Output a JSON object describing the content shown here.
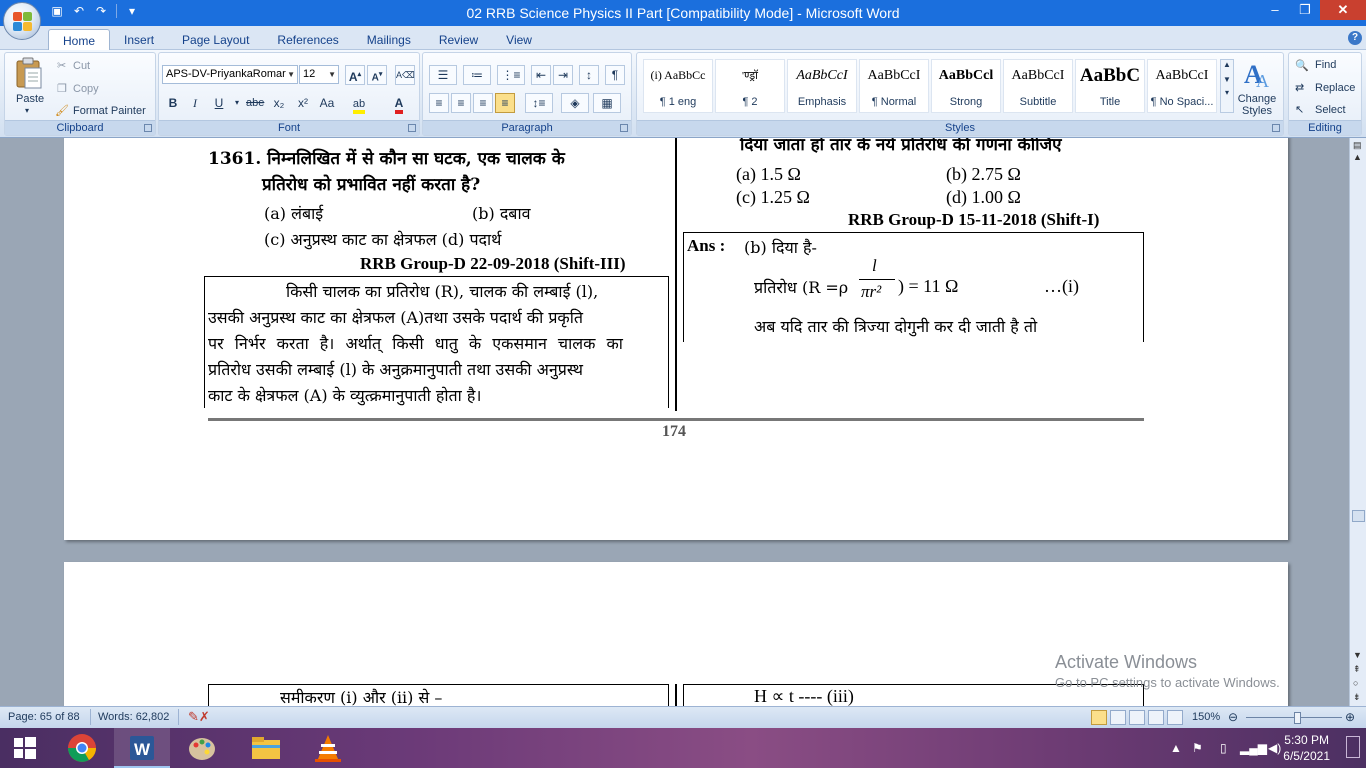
{
  "window": {
    "title": "02 RRB Science Physics II Part [Compatibility Mode] - Microsoft Word",
    "minimize": "–",
    "restore": "❐",
    "close": "✕"
  },
  "tabs": [
    "Home",
    "Insert",
    "Page Layout",
    "References",
    "Mailings",
    "Review",
    "View"
  ],
  "ribbon": {
    "clipboard": {
      "label": "Clipboard",
      "paste": "Paste",
      "cut": "Cut",
      "copy": "Copy",
      "format_painter": "Format Painter"
    },
    "font": {
      "label": "Font",
      "font_name": "APS-DV-PriyankaRomar",
      "font_size": "12",
      "bold": "B",
      "italic": "I",
      "underline": "U",
      "strike": "abe",
      "subscript": "x₂",
      "superscript": "x²",
      "change_case": "Aa"
    },
    "paragraph": {
      "label": "Paragraph"
    },
    "styles": {
      "label": "Styles",
      "items": [
        {
          "sample": "(i) AaBbCc",
          "name": "¶ 1 eng"
        },
        {
          "sample": "'ण्ड्रॉ",
          "name": "¶ 2"
        },
        {
          "sample": "AaBbCcI",
          "name": "Emphasis"
        },
        {
          "sample": "AaBbCcI",
          "name": "¶ Normal"
        },
        {
          "sample": "AaBbCcl",
          "name": "Strong"
        },
        {
          "sample": "AaBbCcI",
          "name": "Subtitle"
        },
        {
          "sample": "AaBbC",
          "name": "Title"
        },
        {
          "sample": "AaBbCcI",
          "name": "¶ No Spaci..."
        }
      ],
      "change_styles": "Change Styles"
    },
    "editing": {
      "label": "Editing",
      "find": "Find",
      "replace": "Replace",
      "select": "Select"
    }
  },
  "document": {
    "q1361": {
      "line1": "1361. निम्नलिखित में से कौन सा घटक, एक चालक के",
      "line2": "प्रतिरोध को प्रभावित नहीं करता है?",
      "opt_a": "(a) लंबाई",
      "opt_b": "(b) दबाव",
      "opt_c": "(c) अनुप्रस्थ काट का क्षेत्रफल (d) पदार्थ",
      "source": "RRB Group-D 22-09-2018 (Shift-III)"
    },
    "answer_left": {
      "l1": "किसी चालक का प्रतिरोध (R), चालक की लम्बाई (l),",
      "l2": "उसकी अनुप्रस्थ काट का क्षेत्रफल (A)तथा उसके पदार्थ की प्रकृति",
      "l3": "पर निर्भर करता है। अर्थात् किसी धातु के एकसमान चालक का",
      "l4": "प्रतिरोध उसकी लम्बाई (l) के अनुक्रमानुपाती तथा उसकी अनुप्रस्थ",
      "l5": "काट के क्षेत्रफल (A) के व्युत्क्रमानुपाती होता है।"
    },
    "right_col": {
      "top_partial": "दिया जाता हो तार के नये प्रतिरोध की गणना कीजिए",
      "opt_a": "(a)   1.5 Ω",
      "opt_b": "(b)   2.75 Ω",
      "opt_c": "(c)   1.25 Ω",
      "opt_d": "(d)   1.00 Ω",
      "source": "RRB Group-D  15-11-2018 (Shift-I)",
      "ans_label": "Ans :",
      "ans_text": "(b) दिया है-",
      "formula_prefix": "प्रतिरोध  (R =ρ",
      "formula_num": "l",
      "formula_den": "πr²",
      "formula_suffix": ") = 11 Ω",
      "formula_ref": "…(i)",
      "next_line": "अब यदि तार की त्रिज्या दोगुनी कर दी जाती है तो"
    },
    "page_number": "174",
    "next_page": {
      "left": "समीकरण (i) और (ii) से –",
      "right": "H ∝ t     ---- (iii)"
    }
  },
  "statusbar": {
    "page": "Page: 65 of 88",
    "words": "Words: 62,802",
    "zoom": "150%"
  },
  "watermark": {
    "line1": "Activate Windows",
    "line2": "Go to PC settings to activate Windows."
  },
  "taskbar": {
    "time": "5:30 PM",
    "date": "6/5/2021"
  },
  "colors": {
    "titlebar": "#1b6fdd",
    "ribbon_text": "#15428b",
    "close_button": "#c9402f"
  }
}
